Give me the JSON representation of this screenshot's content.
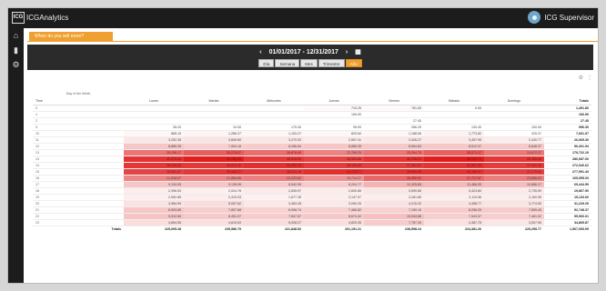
{
  "app": {
    "logo_badge": "ICG",
    "logo_text": "ICGAnalytics",
    "user_name": "ICG Supervisor"
  },
  "sidebar": [
    {
      "icon": "home-icon",
      "glyph": "⌂"
    },
    {
      "icon": "bar-chart-icon",
      "glyph": "▮"
    },
    {
      "icon": "gear-icon",
      "glyph": "⚙"
    }
  ],
  "filter_tab": "When do you sell more?",
  "date_range": "01/01/2017 - 12/31/2017",
  "period_tabs": [
    "Día",
    "Semana",
    "Mes",
    "Trimestre",
    "Año"
  ],
  "active_period": "Año",
  "tools": {
    "settings": "⚙",
    "more": "⋮"
  },
  "table": {
    "dimension_label": "Day of the Week",
    "row_label": "Time",
    "columns": [
      "Lunes",
      "Martes",
      "Miércoles",
      "Jueves",
      "Viernes",
      "Sábado",
      "Domingo"
    ],
    "total_label": "Totals",
    "rows": [
      {
        "h": "0",
        "v": [
          "",
          "",
          "",
          "710.25",
          "781.50",
          "0.05",
          ""
        ],
        "t": "1,491.80"
      },
      {
        "h": "1",
        "v": [
          "",
          "",
          "",
          "106.90",
          "",
          "",
          ""
        ],
        "t": "106.90"
      },
      {
        "h": "2",
        "v": [
          "",
          "",
          "",
          "",
          "27.45",
          "",
          ""
        ],
        "t": "27.45"
      },
      {
        "h": "9",
        "v": [
          "35.20",
          "10.00",
          "175.30",
          "95.00",
          "266.25",
          "130.40",
          "100.00"
        ],
        "t": "956.30"
      },
      {
        "h": "10",
        "v": [
          "885.15",
          "1,266.27",
          "1,153.27",
          "829.60",
          "1,188.55",
          "1,773.82",
          "325.37"
        ],
        "t": "7,661.97"
      },
      {
        "h": "11",
        "v": [
          "3,252.35",
          "3,849.60",
          "3,270.92",
          "2,557.41",
          "3,326.27",
          "3,457.95",
          "2,430.77"
        ],
        "t": "26,065.30"
      },
      {
        "h": "12",
        "v": [
          "8,880.35",
          "7,554.18",
          "8,286.84",
          "8,885.35",
          "8,554.83",
          "8,512.97",
          "8,648.37"
        ],
        "t": "56,301.94"
      },
      {
        "h": "13",
        "v": [
          "25,208.17",
          "30,275.07",
          "26,878.40",
          "22,789.25",
          "25,394.75",
          "30,071.17",
          "24,672.37"
        ],
        "t": "179,722.19"
      },
      {
        "h": "13",
        "v": [
          "40,275.40",
          "44,785.05",
          "38,818.82",
          "36,553.86",
          "40,236.91",
          "45,102.74",
          "39,455.06"
        ],
        "t": "280,087.00"
      },
      {
        "h": "14",
        "v": [
          "38,928.55",
          "38,870.40",
          "40,995.15",
          "38,189.80",
          "37,982.57",
          "40,087.05",
          "37,940.38"
        ],
        "t": "272,940.62"
      },
      {
        "h": "15",
        "v": [
          "36,551.57",
          "39,068.27",
          "38,511.16",
          "41,178.77",
          "39,895.55",
          "40,108.47",
          "37,279.94"
        ],
        "t": "277,591.43"
      },
      {
        "h": "16",
        "v": [
          "21,918.07",
          "21,884.85",
          "23,123.82",
          "19,714.27",
          "28,400.91",
          "27,717.57",
          "23,866.03"
        ],
        "t": "165,955.03"
      },
      {
        "h": "17",
        "v": [
          "9,134.05",
          "9,135.99",
          "8,542.95",
          "8,204.77",
          "12,425.85",
          "11,466.05",
          "10,686.17"
        ],
        "t": "69,444.59"
      },
      {
        "h": "18",
        "v": [
          "2,396.93",
          "2,024.78",
          "2,835.97",
          "2,600.85",
          "3,590.85",
          "3,423.80",
          "2,735.59"
        ],
        "t": "19,867.90"
      },
      {
        "h": "19",
        "v": [
          "2,062.85",
          "2,410.03",
          "1,677.35",
          "2,147.97",
          "2,281.85",
          "2,119.56",
          "2,160.55"
        ],
        "t": "15,133.60"
      },
      {
        "h": "20",
        "v": [
          "3,984.99",
          "5,057.62",
          "3,463.45",
          "3,090.25",
          "4,215.32",
          "4,458.77",
          "3,774.90"
        ],
        "t": "31,229.29"
      },
      {
        "h": "21",
        "v": [
          "8,903.85",
          "7,807.68",
          "6,908.74",
          "7,466.82",
          "7,159.15",
          "8,256.25",
          "7,895.45"
        ],
        "t": "52,748.37"
      },
      {
        "h": "22",
        "v": [
          "9,312.60",
          "8,451.07",
          "7,847.67",
          "8,674.42",
          "10,044.88",
          "7,543.57",
          "7,481.52"
        ],
        "t": "55,960.01"
      },
      {
        "h": "23",
        "v": [
          "4,894.55",
          "4,619.53",
          "5,028.27",
          "4,829.35",
          "7,787.26",
          "4,387.75",
          "3,507.55"
        ],
        "t": "34,865.87"
      }
    ],
    "footer": {
      "label": "Totals",
      "v": [
        "225,005.28",
        "235,586.79",
        "221,848.52",
        "201,191.21",
        "238,598.24",
        "224,381.26",
        "225,255.77"
      ],
      "t": "1,567,093.09"
    }
  },
  "colors": {
    "accent": "#f0a030",
    "heat_max": "#e02020",
    "header_bg": "#1c1c1c"
  }
}
